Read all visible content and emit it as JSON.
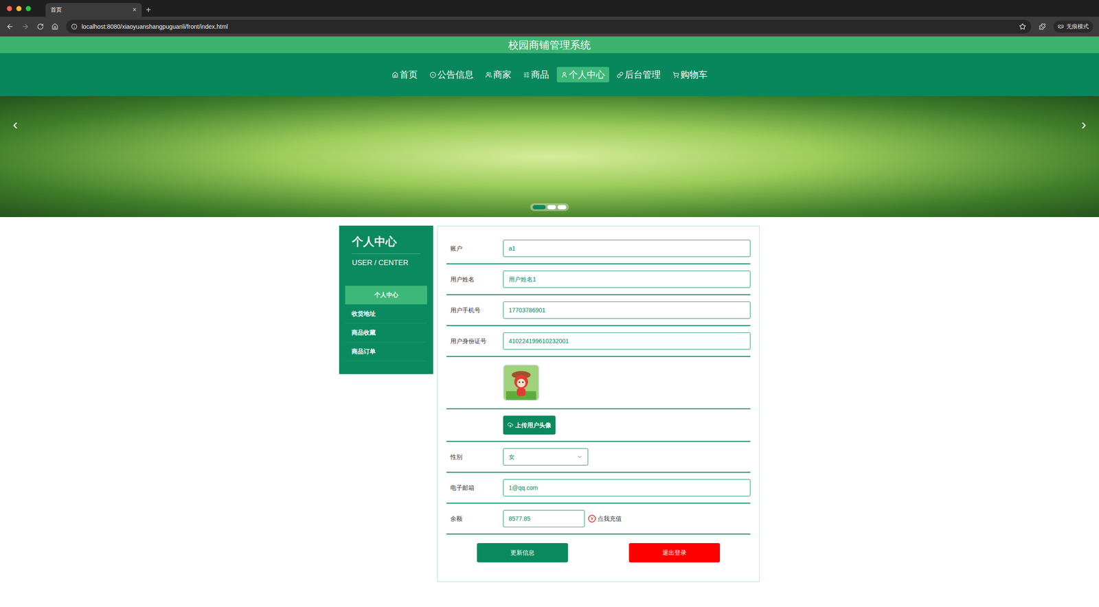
{
  "browser": {
    "tab_title": "首页",
    "tab_close": "×",
    "new_tab": "+",
    "url": "localhost:8080/xiaoyuanshangpuguanli/front/index.html",
    "incognito": "无痕模式"
  },
  "site": {
    "title": "校园商铺管理系统"
  },
  "nav": [
    {
      "label": "首页",
      "selected": false
    },
    {
      "label": "公告信息",
      "selected": false
    },
    {
      "label": "商家",
      "selected": false
    },
    {
      "label": "商品",
      "selected": false
    },
    {
      "label": "个人中心",
      "selected": true
    },
    {
      "label": "后台管理",
      "selected": false
    },
    {
      "label": "购物车",
      "selected": false
    }
  ],
  "banner": {
    "prev": "‹",
    "next": "›",
    "dots": [
      {
        "selected": true
      },
      {
        "selected": false
      },
      {
        "selected": false
      }
    ]
  },
  "sidebar": {
    "title": "个人中心",
    "subtitle": "USER / CENTER",
    "items": [
      {
        "label": "个人中心",
        "selected": true
      },
      {
        "label": "收货地址",
        "selected": false
      },
      {
        "label": "商品收藏",
        "selected": false
      },
      {
        "label": "商品订单",
        "selected": false
      }
    ]
  },
  "form": {
    "fields": [
      {
        "kind": "text",
        "label": "账户",
        "value": "a1"
      },
      {
        "kind": "text",
        "label": "用户姓名",
        "value": "用户姓名1"
      },
      {
        "kind": "text",
        "label": "用户手机号",
        "value": "17703786901"
      },
      {
        "kind": "text",
        "label": "用户身份证号",
        "value": "410224199610232001"
      },
      {
        "kind": "avatar",
        "label": "",
        "value": ""
      },
      {
        "kind": "upload",
        "label": "",
        "value": "上传用户头像"
      },
      {
        "kind": "select",
        "label": "性别",
        "value": "女"
      },
      {
        "kind": "text",
        "label": "电子邮箱",
        "value": "1@qq.com"
      },
      {
        "kind": "balance",
        "label": "余额",
        "value": "8577.85",
        "currency": "¥",
        "recharge": "点我充值"
      }
    ],
    "buttons": [
      {
        "label": "更新信息",
        "color": "#0b8a5f"
      },
      {
        "label": "退出登录",
        "color": "#ff0000"
      }
    ]
  }
}
